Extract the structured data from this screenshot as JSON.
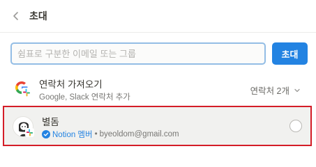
{
  "header": {
    "title": "초대",
    "back_icon": "chevron-left-icon"
  },
  "invite": {
    "placeholder": "쉼표로 구분한 이메일 또는 그룹",
    "value": "",
    "button_label": "초대"
  },
  "contacts": {
    "title": "연락처 가져오기",
    "subtitle": "Google, Slack 연락처 추가",
    "count": "연락처 2개",
    "icons": [
      "google-logo-icon",
      "slack-logo-icon",
      "chevron-down-icon"
    ]
  },
  "member": {
    "name": "별돔",
    "badge": "Notion 멤버",
    "separator": "•",
    "email": "byeoldom@gmail.com",
    "icons": [
      "avatar",
      "slack-logo-icon",
      "verified-check-icon",
      "radio-icon"
    ],
    "selected": false
  },
  "colors": {
    "accent": "#2383e2",
    "highlight_border": "#d41d27",
    "input_border": "#93bde5"
  }
}
